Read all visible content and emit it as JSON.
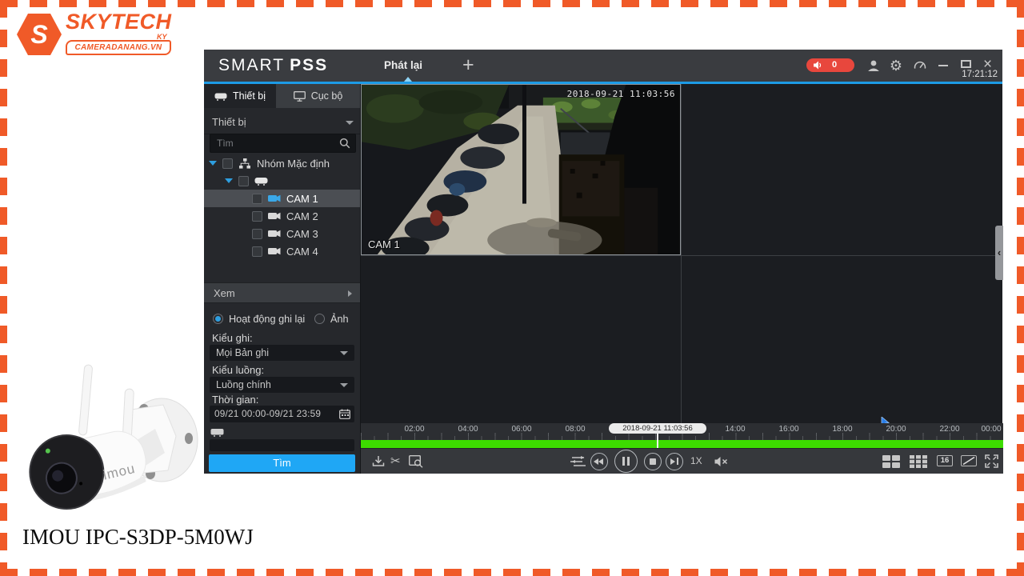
{
  "page": {
    "caption": "IMOU IPC-S3DP-5M0WJ"
  },
  "logo": {
    "brand": "SKYTECH",
    "brand_suffix": "KY",
    "site": "CAMERADANANG.VN"
  },
  "colors": {
    "brand_orange": "#f05a28",
    "accent_blue": "#1d9be6",
    "badge_red": "#e8473d",
    "button_blue": "#1fa7f5",
    "timeline_green": "#3ddc00",
    "selected_row": "#4b4e53"
  },
  "header": {
    "title_regular": "SMART",
    "title_bold": "PSS",
    "tab_playback": "Phát lại",
    "new_tab_plus": "+",
    "alarm_count": "0",
    "clock": "17:21:12"
  },
  "sidebar": {
    "tab_device": "Thiết bị",
    "tab_local": "Cục bộ",
    "device_select_value": "Thiết bị",
    "search_placeholder": "Tìm",
    "tree_group_label": "Nhóm Mặc định",
    "cameras": [
      {
        "label": "CAM 1"
      },
      {
        "label": "CAM 2"
      },
      {
        "label": "CAM 3"
      },
      {
        "label": "CAM 4"
      }
    ],
    "selected_camera": "CAM 1",
    "view_section_label": "Xem",
    "radio_record_label": "Hoạt động ghi lại",
    "radio_photo_label": "Ảnh",
    "record_type_label": "Kiểu ghi:",
    "record_type_value": "Mọi Bản ghi",
    "stream_type_label": "Kiểu luồng:",
    "stream_type_value": "Luồng chính",
    "time_label": "Thời gian:",
    "time_range_value": "09/21 00:00-09/21 23:59",
    "search_button_label": "Tìm"
  },
  "player": {
    "osd_timestamp": "2018-09-21 11:03:56",
    "camera_name_overlay": "CAM 1",
    "speed_label": "1X",
    "view_16_label": "16"
  },
  "timeline": {
    "current_time_label": "2018-09-21 11:03:56",
    "tick_labels": [
      "02:00",
      "04:00",
      "06:00",
      "08:00",
      "14:00",
      "16:00",
      "18:00",
      "20:00",
      "22:00",
      "00:00"
    ]
  },
  "glyphs": {
    "gear": "⚙",
    "scissors": "✂",
    "close": "×",
    "collapse": "‹"
  },
  "icons": {
    "search-icon": "svg-magnifier",
    "gear-icon": "unicode-2699",
    "scissors-icon": "unicode-2702",
    "close-icon": "unicode-x",
    "minimize-icon": "css-dash",
    "maximize-icon": "css-box-outline",
    "alarm-speaker-icon": "svg-speaker",
    "person-icon": "svg-person",
    "dashboard-icon": "svg-gauge",
    "device-icon": "svg-recorder",
    "monitor-icon": "svg-monitor",
    "group-icon": "svg-org-nodes",
    "camera-icon": "svg-videocam",
    "checkbox": "css-box",
    "tree-expand-icon": "css-triangle-down-blue",
    "caret-down-icon": "css-triangle-down",
    "view-arrow-icon": "css-triangle-right",
    "radio-icon": "css-circle",
    "calendar-icon": "svg-calendar",
    "download-icon": "svg-download",
    "clip-export-icon": "svg-rect-magnifier",
    "sync-icon": "svg-sliders",
    "rewind-icon": "css-double-triangle-left",
    "pause-icon": "css-two-bars",
    "stop-icon": "css-square",
    "next-frame-icon": "css-triangle-bar",
    "mute-icon": "svg-speaker-x",
    "grid-4-icon": "svg-grid-2x2",
    "grid-9-icon": "svg-grid-3x3",
    "custom-split-icon": "svg-diagonal-box",
    "fullscreen-icon": "svg-corner-arrows",
    "collapse-panel-icon": "unicode-chevron-left",
    "tab-pointer-icon": "css-triangle-up",
    "mouse-cursor-icon": "svg-pointer"
  }
}
